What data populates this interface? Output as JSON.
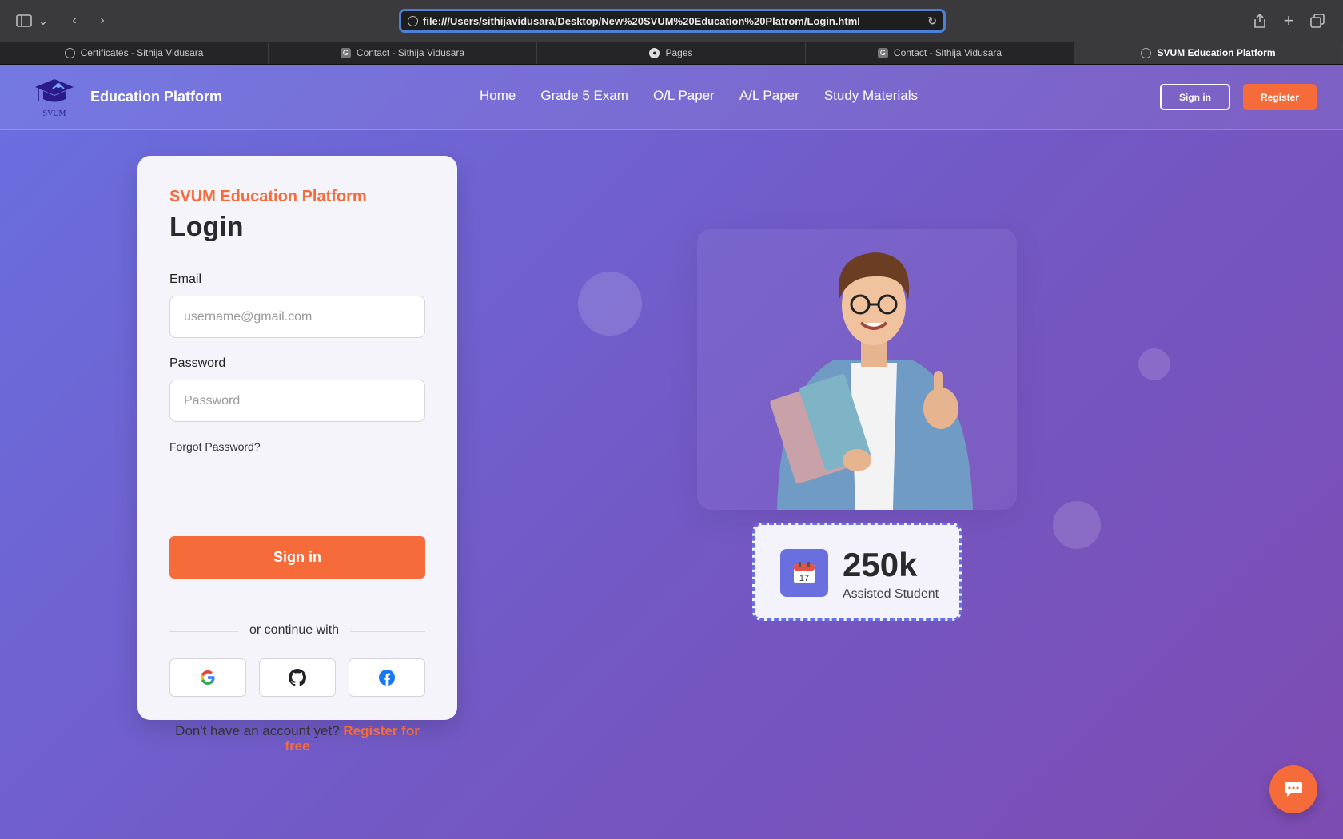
{
  "browser": {
    "url": "file:///Users/sithijavidusara/Desktop/New%20SVUM%20Education%20Platrom/Login.html",
    "tabs": [
      {
        "label": "Certificates - Sithija Vidusara",
        "icon": "compass-icon"
      },
      {
        "label": "Contact - Sithija Vidusara",
        "icon": "g-icon"
      },
      {
        "label": "Pages",
        "icon": "github-icon"
      },
      {
        "label": "Contact - Sithija Vidusara",
        "icon": "g-icon"
      },
      {
        "label": "SVUM Education Platform",
        "icon": "compass-icon",
        "active": true
      }
    ]
  },
  "nav": {
    "logo_text": "SVUM",
    "brand": "Education Platform",
    "links": [
      "Home",
      "Grade 5 Exam",
      "O/L Paper",
      "A/L Paper",
      "Study Materials"
    ],
    "signin": "Sign in",
    "register": "Register"
  },
  "login": {
    "brand": "SVUM Education Platform",
    "title": "Login",
    "email_label": "Email",
    "email_placeholder": "username@gmail.com",
    "password_label": "Password",
    "password_placeholder": "Password",
    "forgot": "Forgot Password?",
    "signin": "Sign in",
    "divider": "or continue with",
    "footer_text": "Don't have an account yet?",
    "footer_link": "Register for free"
  },
  "stat": {
    "value": "250k",
    "label": "Assisted Student",
    "icon": "calendar-icon",
    "icon_text": "17"
  },
  "colors": {
    "accent": "#f56b3a",
    "primary": "#6a6fe0"
  }
}
